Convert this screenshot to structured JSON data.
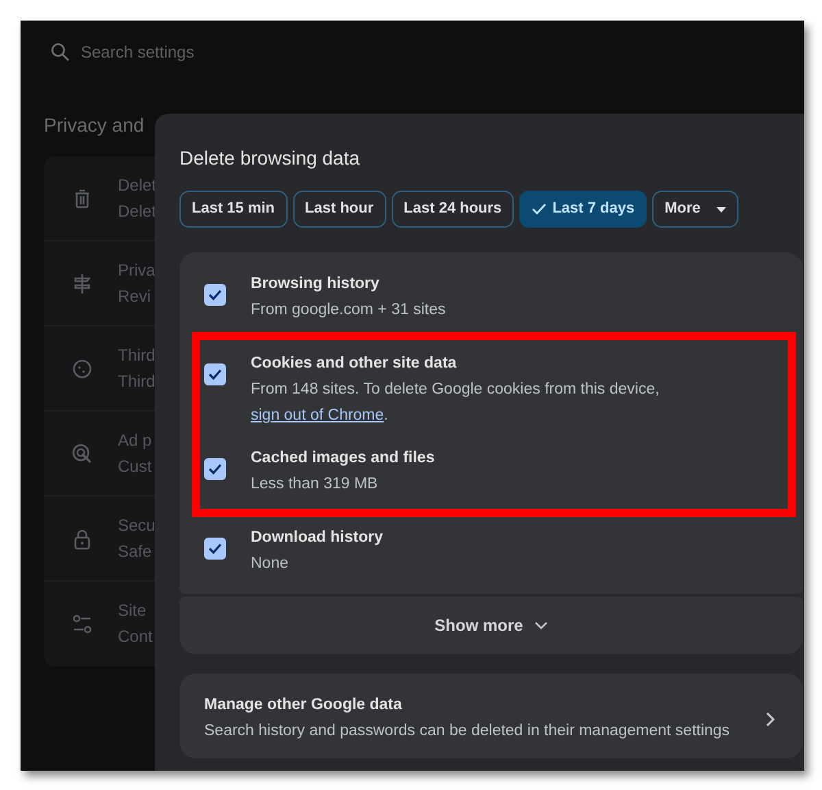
{
  "search": {
    "placeholder": "Search settings"
  },
  "background_page": {
    "heading": "Privacy and",
    "items": [
      {
        "title": "Delet",
        "subtitle": "Delet"
      },
      {
        "title": "Priva",
        "subtitle": "Revi"
      },
      {
        "title": "Third",
        "subtitle": "Third"
      },
      {
        "title": "Ad p",
        "subtitle": "Cust"
      },
      {
        "title": "Secu",
        "subtitle": "Safe"
      },
      {
        "title": "Site",
        "subtitle": "Cont"
      }
    ]
  },
  "dialog": {
    "title": "Delete browsing data",
    "time_ranges": [
      {
        "label": "Last 15 min",
        "selected": false,
        "kind": "chip"
      },
      {
        "label": "Last hour",
        "selected": false,
        "kind": "chip"
      },
      {
        "label": "Last 24 hours",
        "selected": false,
        "kind": "chip"
      },
      {
        "label": "Last 7 days",
        "selected": true,
        "kind": "chip"
      },
      {
        "label": "More",
        "selected": false,
        "kind": "dropdown"
      }
    ],
    "options": [
      {
        "title": "Browsing history",
        "detail": "From google.com + 31 sites",
        "checked": true,
        "highlighted": false
      },
      {
        "title": "Cookies and other site data",
        "detail": "From 148 sites. To delete Google cookies from this device, ",
        "link": "sign out of Chrome",
        "detail_end": ".",
        "checked": true,
        "highlighted": true
      },
      {
        "title": "Cached images and files",
        "detail": "Less than 319 MB",
        "checked": true,
        "highlighted": true
      },
      {
        "title": "Download history",
        "detail": "None",
        "checked": true,
        "highlighted": false
      }
    ],
    "show_more": "Show more",
    "manage": {
      "title": "Manage other Google data",
      "description": "Search history and passwords can be deleted in their management settings"
    }
  }
}
